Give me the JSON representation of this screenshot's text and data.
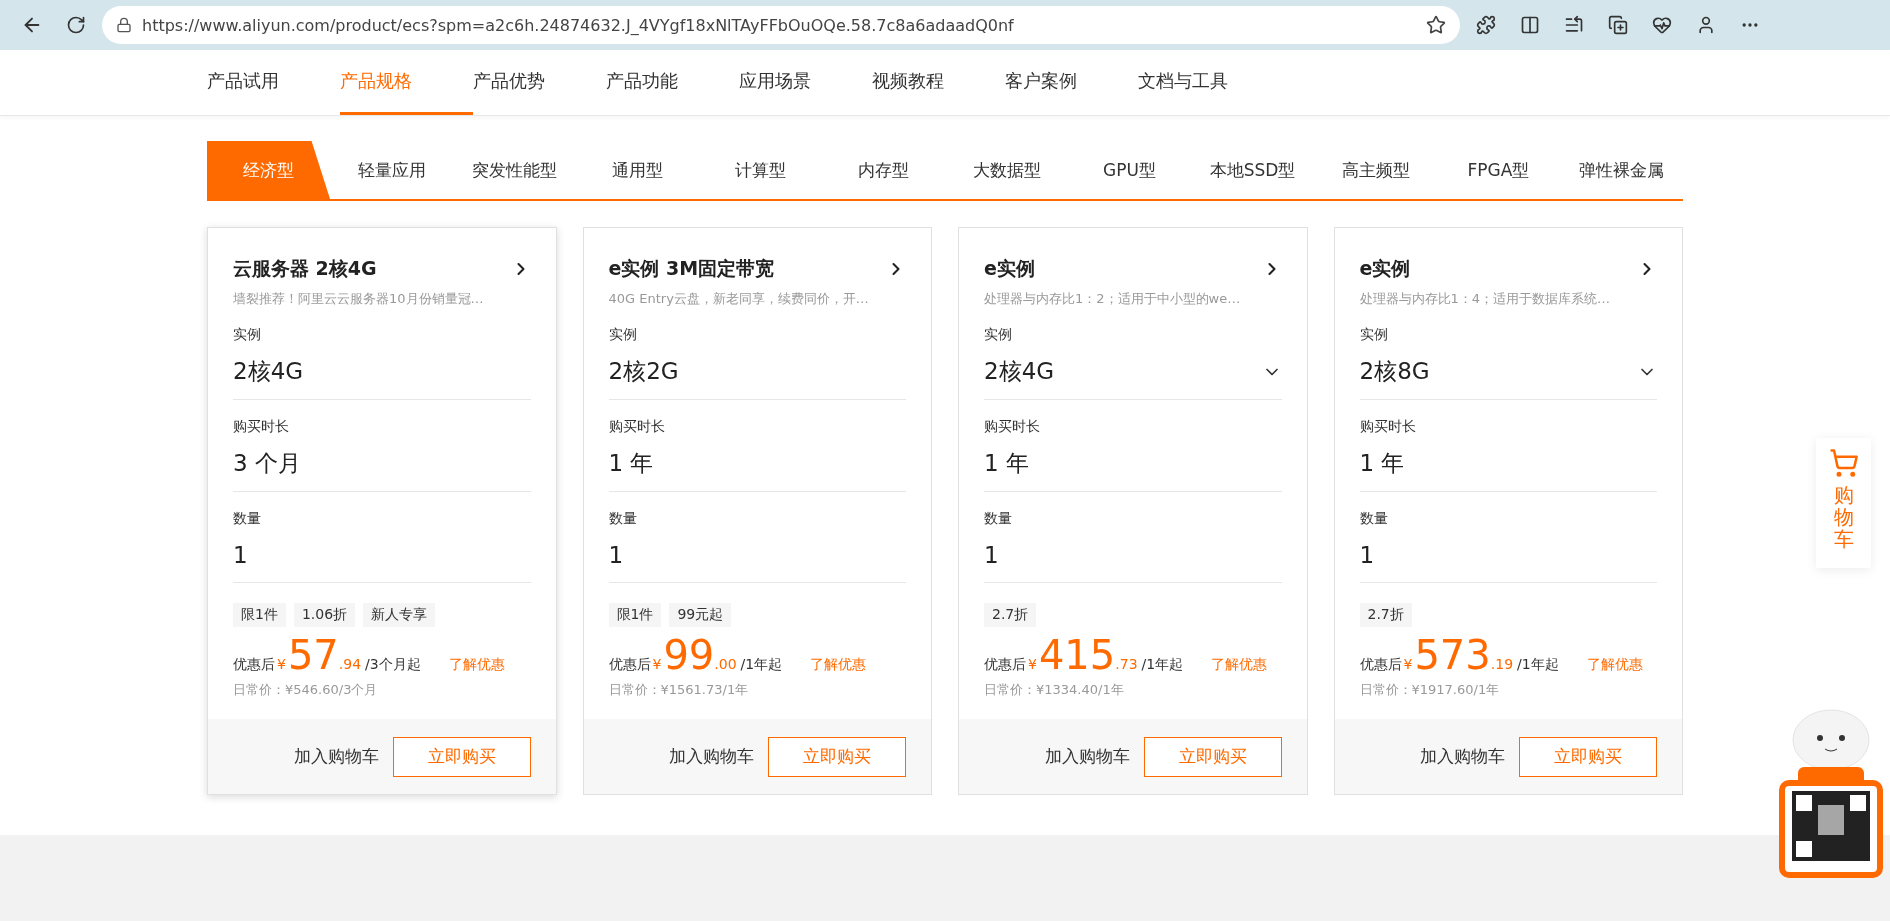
{
  "browser": {
    "url": "https://www.aliyun.com/product/ecs?spm=a2c6h.24874632.J_4VYgf18xNlTAyFFbOuOQe.58.7c8a6adaadQ0nf"
  },
  "nav": [
    {
      "label": "产品试用",
      "selected": false
    },
    {
      "label": "产品规格",
      "selected": true
    },
    {
      "label": "产品优势",
      "selected": false
    },
    {
      "label": "产品功能",
      "selected": false
    },
    {
      "label": "应用场景",
      "selected": false
    },
    {
      "label": "视频教程",
      "selected": false
    },
    {
      "label": "客户案例",
      "selected": false
    },
    {
      "label": "文档与工具",
      "selected": false
    }
  ],
  "tabs": [
    {
      "label": "经济型",
      "selected": true
    },
    {
      "label": "轻量应用",
      "selected": false
    },
    {
      "label": "突发性能型",
      "selected": false
    },
    {
      "label": "通用型",
      "selected": false
    },
    {
      "label": "计算型",
      "selected": false
    },
    {
      "label": "内存型",
      "selected": false
    },
    {
      "label": "大数据型",
      "selected": false
    },
    {
      "label": "GPU型",
      "selected": false
    },
    {
      "label": "本地SSD型",
      "selected": false
    },
    {
      "label": "高主频型",
      "selected": false
    },
    {
      "label": "FPGA型",
      "selected": false
    },
    {
      "label": "弹性裸金属",
      "selected": false
    }
  ],
  "cards": [
    {
      "title": "云服务器 2核4G",
      "subtitle": "墙裂推荐！阿里云云服务器10月份销量冠…",
      "fields": [
        {
          "label": "实例",
          "value": "2核4G",
          "dropdown": false
        },
        {
          "label": "购买时长",
          "value": "3 个月",
          "dropdown": false
        },
        {
          "label": "数量",
          "value": "1",
          "dropdown": false
        }
      ],
      "tags": [
        "限1件",
        "1.06折",
        "新人专享"
      ],
      "price": {
        "prefix": "优惠后",
        "currency": "¥",
        "integer": "57",
        "decimal": ".94",
        "unit": "/3个月起",
        "link": "了解优惠",
        "regular": "日常价：¥546.60/3个月"
      },
      "add_cart": "加入购物车",
      "buy": "立即购买",
      "raised": true
    },
    {
      "title": "e实例 3M固定带宽",
      "subtitle": "40G Entry云盘，新老同享，续费同价，开…",
      "fields": [
        {
          "label": "实例",
          "value": "2核2G",
          "dropdown": false
        },
        {
          "label": "购买时长",
          "value": "1 年",
          "dropdown": false
        },
        {
          "label": "数量",
          "value": "1",
          "dropdown": false
        }
      ],
      "tags": [
        "限1件",
        "99元起"
      ],
      "price": {
        "prefix": "优惠后",
        "currency": "¥",
        "integer": "99",
        "decimal": ".00",
        "unit": "/1年起",
        "link": "了解优惠",
        "regular": "日常价：¥1561.73/1年"
      },
      "add_cart": "加入购物车",
      "buy": "立即购买",
      "raised": false
    },
    {
      "title": "e实例",
      "subtitle": "处理器与内存比1：2；适用于中小型的we…",
      "fields": [
        {
          "label": "实例",
          "value": "2核4G",
          "dropdown": true
        },
        {
          "label": "购买时长",
          "value": "1 年",
          "dropdown": false
        },
        {
          "label": "数量",
          "value": "1",
          "dropdown": false
        }
      ],
      "tags": [
        "2.7折"
      ],
      "price": {
        "prefix": "优惠后",
        "currency": "¥",
        "integer": "415",
        "decimal": ".73",
        "unit": "/1年起",
        "link": "了解优惠",
        "regular": "日常价：¥1334.40/1年"
      },
      "add_cart": "加入购物车",
      "buy": "立即购买",
      "raised": false
    },
    {
      "title": "e实例",
      "subtitle": "处理器与内存比1：4；适用于数据库系统…",
      "fields": [
        {
          "label": "实例",
          "value": "2核8G",
          "dropdown": true
        },
        {
          "label": "购买时长",
          "value": "1 年",
          "dropdown": false
        },
        {
          "label": "数量",
          "value": "1",
          "dropdown": false
        }
      ],
      "tags": [
        "2.7折"
      ],
      "price": {
        "prefix": "优惠后",
        "currency": "¥",
        "integer": "573",
        "decimal": ".19",
        "unit": "/1年起",
        "link": "了解优惠",
        "regular": "日常价：¥1917.60/1年"
      },
      "add_cart": "加入购物车",
      "buy": "立即购买",
      "raised": false
    }
  ],
  "side_cart": {
    "label": "购物车"
  }
}
